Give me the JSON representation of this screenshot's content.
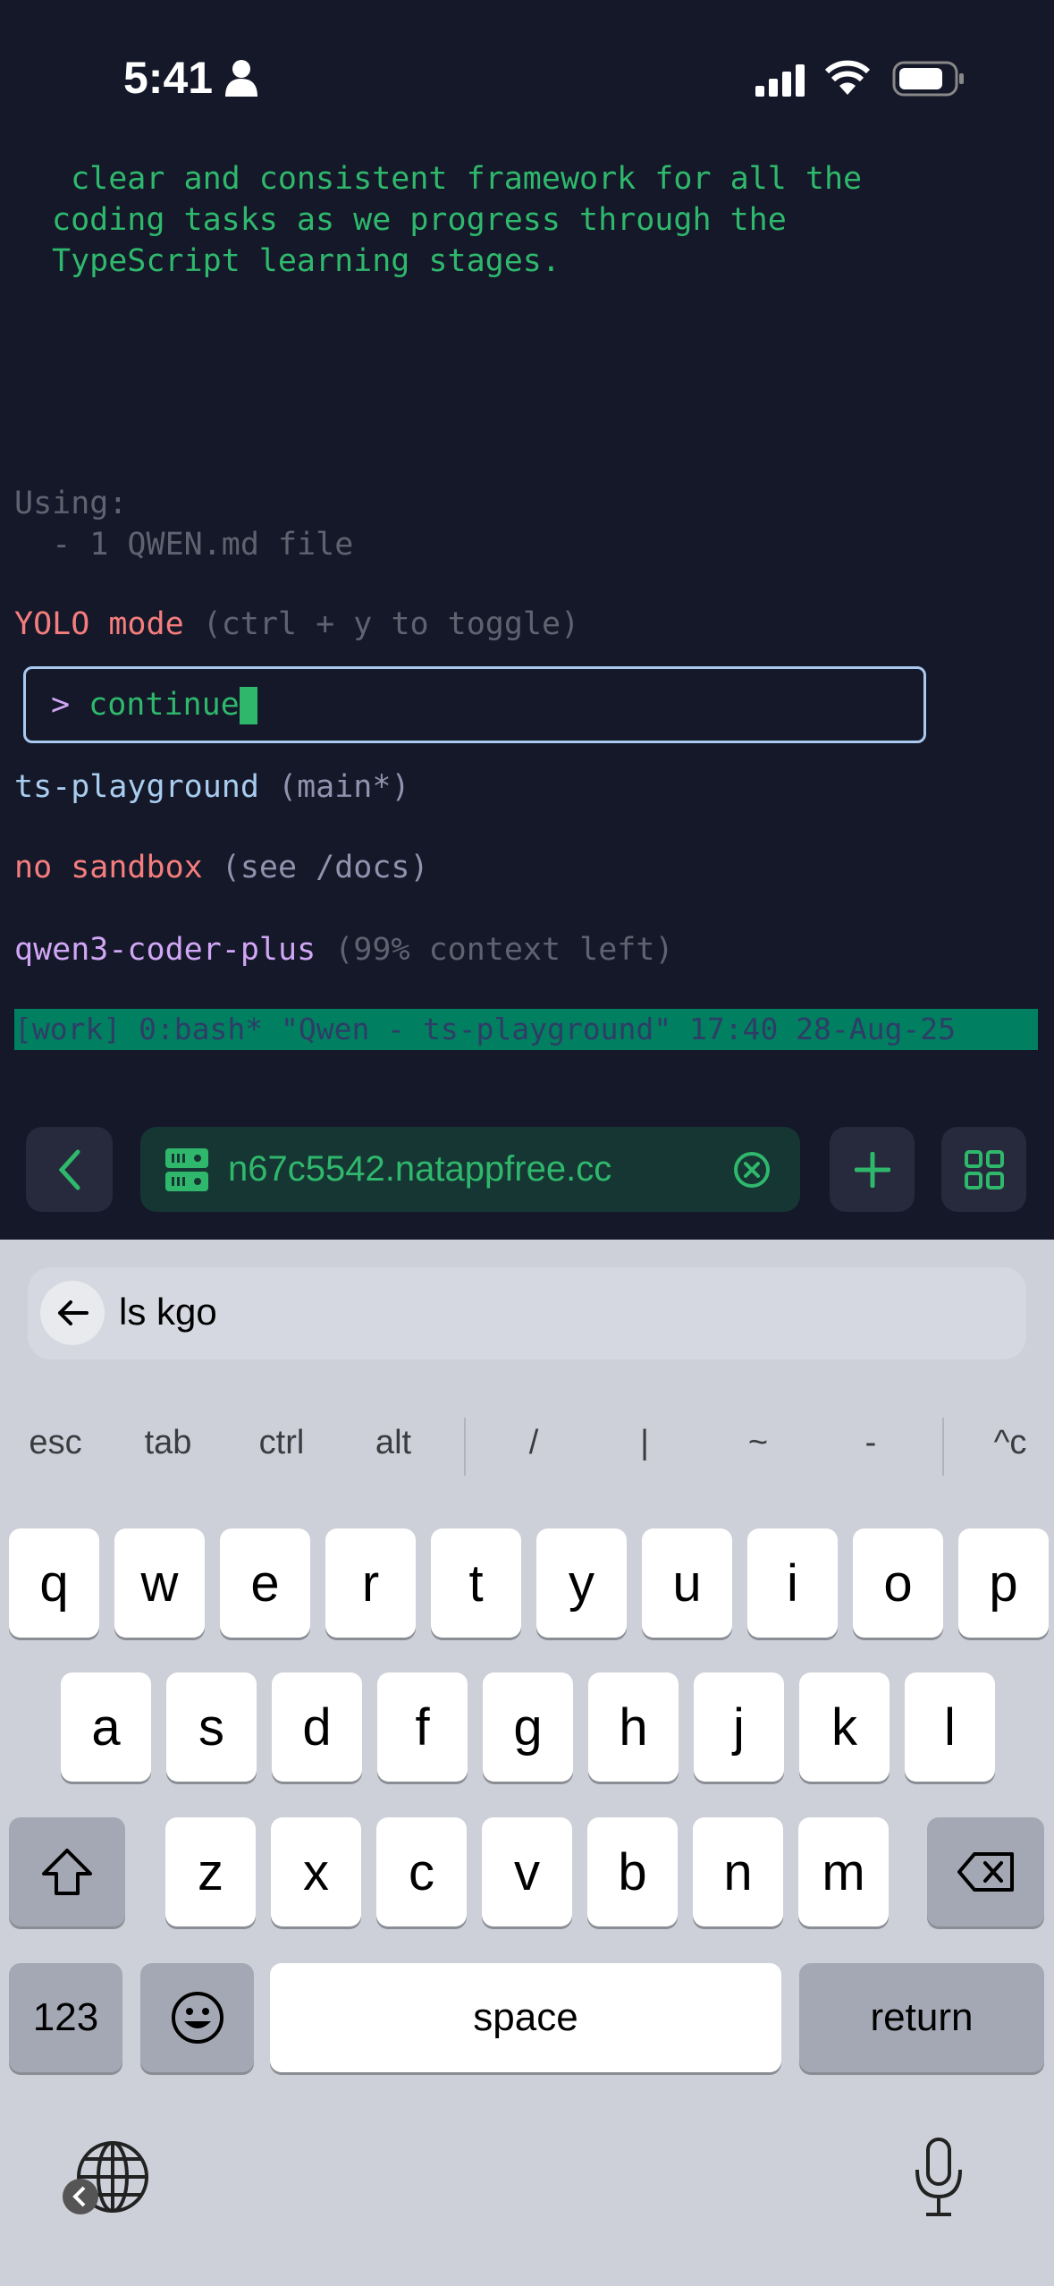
{
  "status_bar": {
    "time": "5:41",
    "icons": [
      "person-icon",
      "cellular-signal-icon",
      "wifi-icon",
      "battery-icon"
    ]
  },
  "terminal": {
    "output_lines": [
      " clear and consistent framework for all the",
      "coding tasks as we progress through the",
      "TypeScript learning stages."
    ],
    "using_label": "Using:",
    "using_item": "  - 1 QWEN.md file",
    "yolo_label": "YOLO mode",
    "yolo_hint": " (ctrl + y to toggle)",
    "prompt_symbol": ">",
    "input_value": "continue",
    "project": "ts-playground",
    "branch": " (main*)",
    "sandbox": "no sandbox",
    "sandbox_hint": " (see /docs)",
    "model": "qwen3-coder-plus",
    "context": " (99% context left)",
    "tmux_status": "[work] 0:bash* \"Qwen - ts-playground\" 17:40 28-Aug-25"
  },
  "toolbar": {
    "host": "n67c5542.natappfree.cc"
  },
  "keyboard": {
    "suggestion": "ls kgo",
    "shortcuts": [
      "esc",
      "tab",
      "ctrl",
      "alt",
      "/",
      "|",
      "~",
      "-",
      "^c"
    ],
    "row1": [
      "q",
      "w",
      "e",
      "r",
      "t",
      "y",
      "u",
      "i",
      "o",
      "p"
    ],
    "row2": [
      "a",
      "s",
      "d",
      "f",
      "g",
      "h",
      "j",
      "k",
      "l"
    ],
    "row3": [
      "z",
      "x",
      "c",
      "v",
      "b",
      "n",
      "m"
    ],
    "numbers": "123",
    "space": "space",
    "return": "return"
  },
  "colors": {
    "background": "#141829",
    "accent_green": "#2fb86c",
    "tmux_bar": "#008060"
  }
}
